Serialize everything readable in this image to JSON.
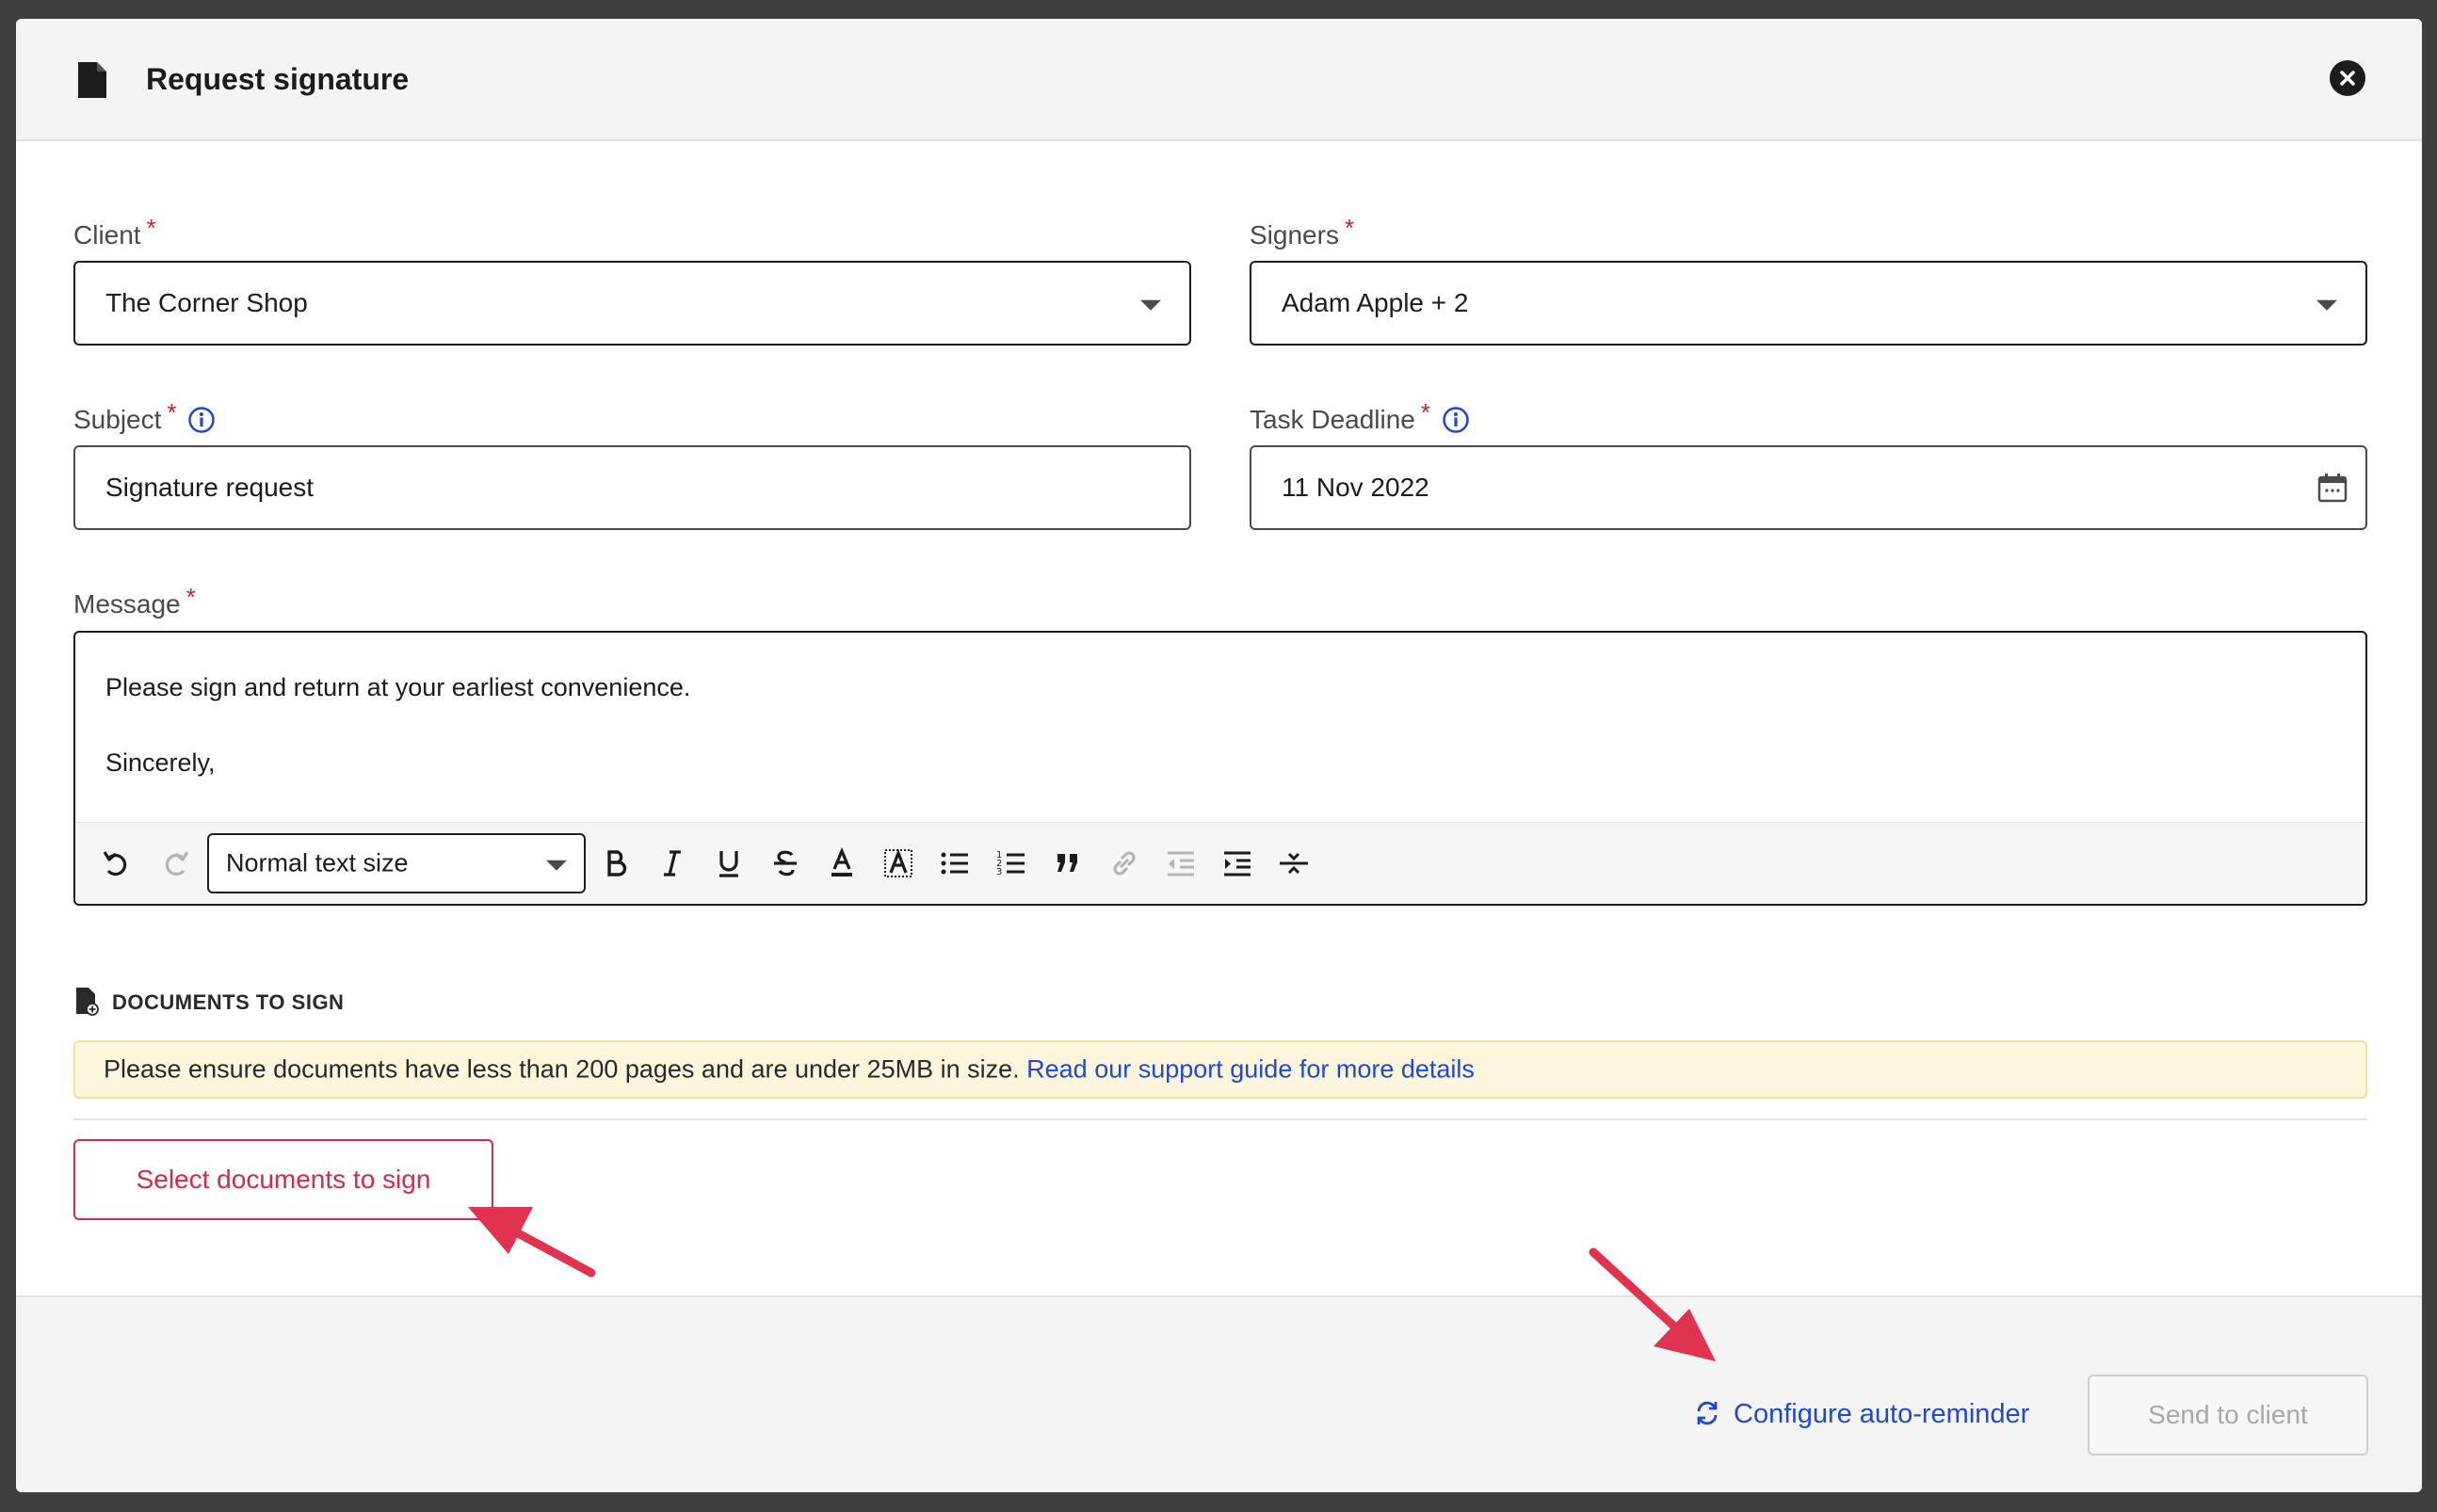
{
  "dialog": {
    "title": "Request signature"
  },
  "form": {
    "client": {
      "label": "Client",
      "required_mark": "*",
      "value": "The Corner Shop"
    },
    "signers": {
      "label": "Signers",
      "required_mark": "*",
      "value": "Adam Apple + 2"
    },
    "subject": {
      "label": "Subject",
      "required_mark": "*",
      "value": "Signature request"
    },
    "task_deadline": {
      "label": "Task Deadline",
      "required_mark": "*",
      "value": "11 Nov 2022"
    },
    "message": {
      "label": "Message",
      "required_mark": "*",
      "line1": "Please sign and return at your earliest convenience.",
      "line2": "Sincerely,"
    }
  },
  "toolbar": {
    "text_size": "Normal text size"
  },
  "documents": {
    "section_title": "DOCUMENTS TO SIGN",
    "notice_text": "Please ensure documents have less than 200 pages and are under 25MB in size.",
    "notice_link": "Read our support guide for more details",
    "select_button": "Select documents to sign"
  },
  "footer": {
    "auto_reminder": "Configure auto-reminder",
    "send_button": "Send to client"
  },
  "colors": {
    "accent_red": "#d62a4a",
    "link_blue": "#2049d1",
    "annotation_arrow": "#e03350",
    "notice_bg": "#fdf6dc"
  }
}
